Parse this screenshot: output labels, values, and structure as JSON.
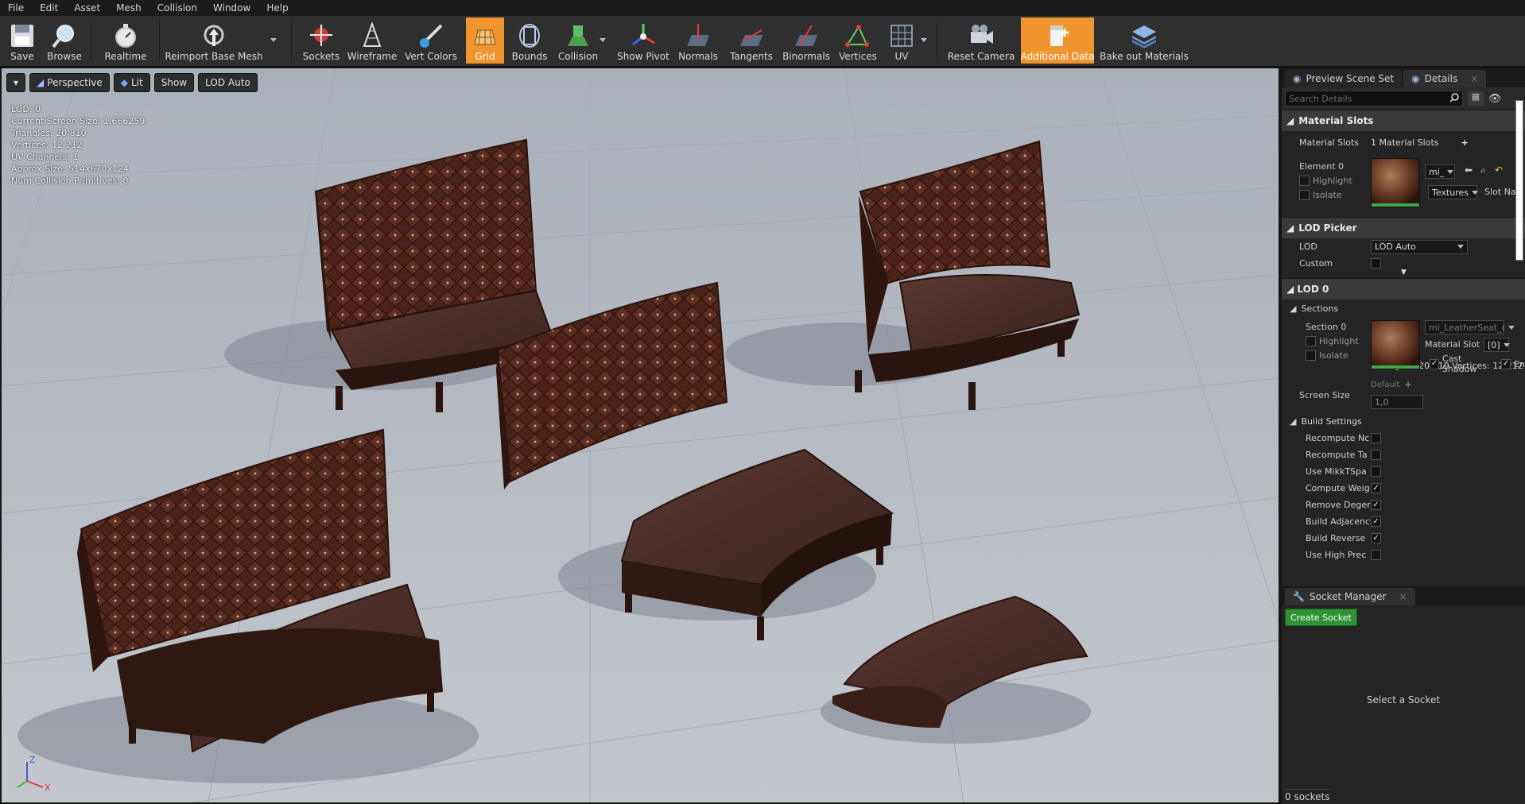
{
  "menu": [
    "File",
    "Edit",
    "Asset",
    "Mesh",
    "Collision",
    "Window",
    "Help"
  ],
  "toolbar": {
    "save": "Save",
    "browse": "Browse",
    "realtime": "Realtime",
    "reimport": "Reimport Base Mesh",
    "sockets": "Sockets",
    "wireframe": "Wireframe",
    "vert_colors": "Vert Colors",
    "grid": "Grid",
    "bounds": "Bounds",
    "collision": "Collision",
    "show_pivot": "Show Pivot",
    "normals": "Normals",
    "tangents": "Tangents",
    "binormals": "Binormals",
    "vertices": "Vertices",
    "uv": "UV",
    "reset_camera": "Reset Camera",
    "additional_data": "Additional Data",
    "bake_out": "Bake out Materials"
  },
  "viewport": {
    "perspective": "Perspective",
    "lit": "Lit",
    "show": "Show",
    "lod": "LOD Auto",
    "stats": [
      "LOD:  0",
      "Current Screen Size:  1,666259",
      "Triangles:  20 810",
      "Vertices:  12 212",
      "UV Channels:  1",
      "Approx Size: 514x670x124",
      "Num Collision Primitives:  0"
    ],
    "axis_z": "Z",
    "axis_x": "X"
  },
  "panel": {
    "tab_preview": "Preview Scene Set",
    "tab_details": "Details",
    "search_placeholder": "Search Details",
    "material_slots_header": "Material Slots",
    "material_slots_label": "Material Slots",
    "material_slots_value": "1 Material Slots",
    "element0": "Element 0",
    "highlight": "Highlight",
    "isolate": "Isolate",
    "mi_combo": "mi_",
    "textures_combo": "Textures",
    "slot_name": "Slot Na",
    "lod_picker_header": "LOD Picker",
    "lod_label": "LOD",
    "lod_value": "LOD Auto",
    "custom_label": "Custom",
    "lod0_header": "LOD 0",
    "lod0_info": "Triangles: 20 810    Vertices: 12 212",
    "sections": "Sections",
    "section0": "Section 0",
    "section_material": "mi_LeatherSeat_(",
    "material_slot_label": "Material Slot",
    "material_slot_value": "[0]",
    "cast_shadow": "Cast Shadow",
    "enable_abbrev": "En",
    "screen_size_label": "Screen Size",
    "screen_size_default": "Default",
    "screen_size_value": "1,0",
    "build_settings": "Build Settings",
    "build": [
      {
        "label": "Recompute Nc",
        "checked": false
      },
      {
        "label": "Recompute Ta",
        "checked": false
      },
      {
        "label": "Use MikkTSpa",
        "checked": false
      },
      {
        "label": "Compute Weig",
        "checked": true
      },
      {
        "label": "Remove Deger",
        "checked": true
      },
      {
        "label": "Build Adjacenc",
        "checked": true
      },
      {
        "label": "Build Reverse",
        "checked": true
      },
      {
        "label": "Use High Prec",
        "checked": false
      }
    ]
  },
  "socket_manager": {
    "tab": "Socket Manager",
    "create": "Create Socket",
    "select": "Select a Socket",
    "count": "0 sockets"
  },
  "colors": {
    "accent": "#f0952d",
    "green": "#2e9135",
    "leather": "#4a2418"
  }
}
